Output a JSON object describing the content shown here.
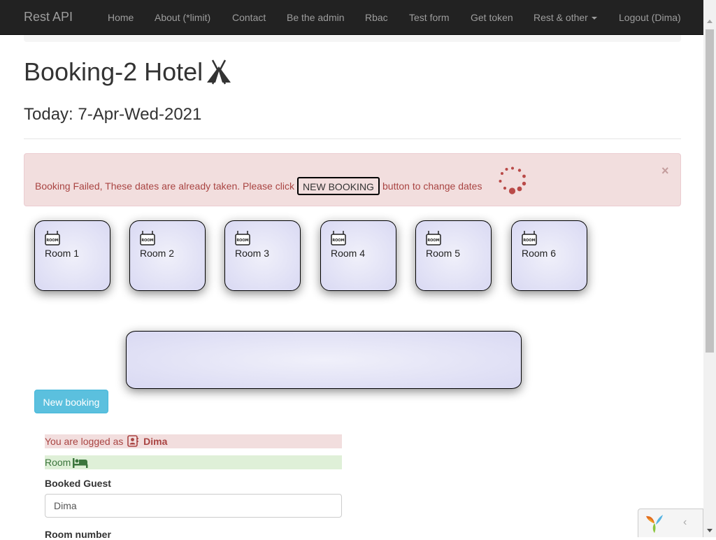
{
  "navbar": {
    "brand": "Rest API",
    "items": [
      "Home",
      "About (*limit)",
      "Contact",
      "Be the admin",
      "Rbac",
      "Test form",
      "Get token",
      "Rest & other",
      "Logout (Dima)"
    ]
  },
  "page": {
    "title": "Booking-2 Hotel",
    "today": "Today: 7-Apr-Wed-2021"
  },
  "alert": {
    "text_before": "Booking Failed, These dates are already taken. Please click",
    "button_label": "NEW BOOKING",
    "text_after": "button to change dates",
    "close": "×"
  },
  "rooms": [
    {
      "label": "Room 1",
      "sign": "ROOM"
    },
    {
      "label": "Room 2",
      "sign": "ROOM"
    },
    {
      "label": "Room 3",
      "sign": "ROOM"
    },
    {
      "label": "Room 4",
      "sign": "ROOM"
    },
    {
      "label": "Room 5",
      "sign": "ROOM"
    },
    {
      "label": "Room 6",
      "sign": "ROOM"
    }
  ],
  "new_booking_button": "New booking",
  "login_info": {
    "prefix": "You are logged as",
    "user": "Dima"
  },
  "room_row_label": "Room",
  "form": {
    "guest_label": "Booked Guest",
    "guest_value": "Dima",
    "room_number_label": "Room number"
  },
  "debug_toolbar": {
    "toggle": "‹"
  }
}
